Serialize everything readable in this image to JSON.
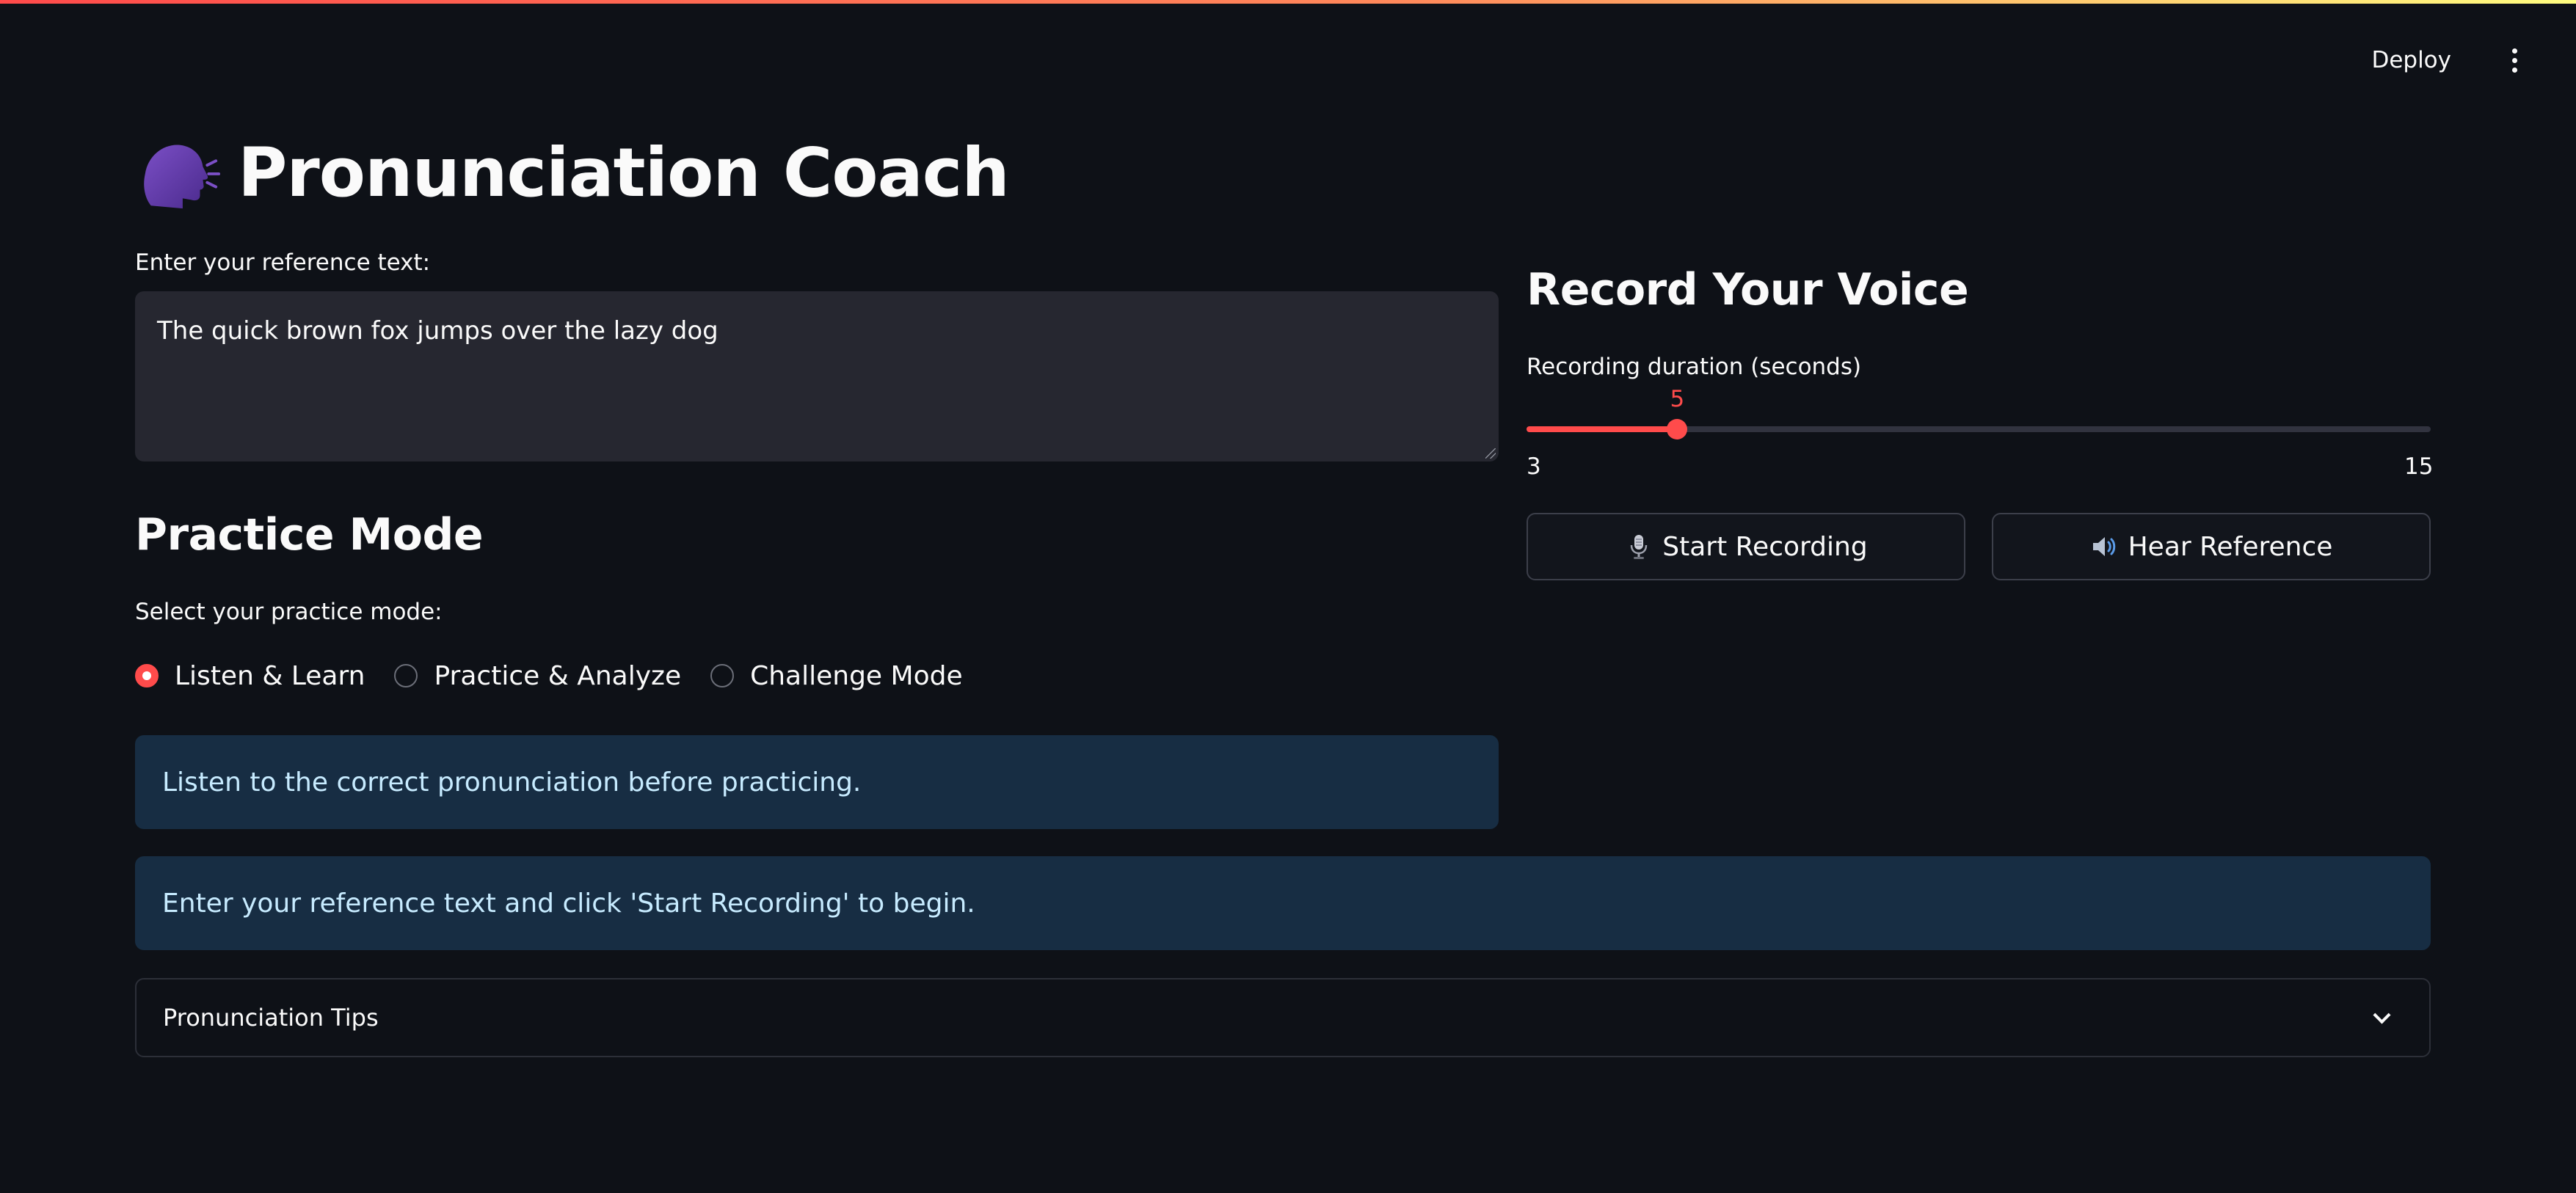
{
  "header": {
    "deploy_label": "Deploy"
  },
  "title": {
    "emoji": "speaking-head-icon",
    "text": "Pronunciation Coach"
  },
  "reference": {
    "label": "Enter your reference text:",
    "value": "The quick brown fox jumps over the lazy dog"
  },
  "practice": {
    "heading": "Practice Mode",
    "select_label": "Select your practice mode:",
    "options": [
      {
        "label": "Listen & Learn",
        "selected": true
      },
      {
        "label": "Practice & Analyze",
        "selected": false
      },
      {
        "label": "Challenge Mode",
        "selected": false
      }
    ],
    "info": "Listen to the correct pronunciation before practicing."
  },
  "record": {
    "heading": "Record Your Voice",
    "slider": {
      "label": "Recording duration (seconds)",
      "value": 5,
      "min": 3,
      "max": 15,
      "min_label": "3",
      "max_label": "15",
      "value_label": "5"
    },
    "start_button": {
      "icon": "microphone-icon",
      "label": "Start Recording"
    },
    "hear_button": {
      "icon": "speaker-icon",
      "label": "Hear Reference"
    }
  },
  "status_info": "Enter your reference text and click 'Start Recording' to begin.",
  "tips": {
    "label": "Pronunciation Tips"
  },
  "colors": {
    "background": "#0e1117",
    "accent": "#ff4b4b",
    "info_bg": "#172d43",
    "info_text": "#c7ebff",
    "input_bg": "#262730"
  }
}
